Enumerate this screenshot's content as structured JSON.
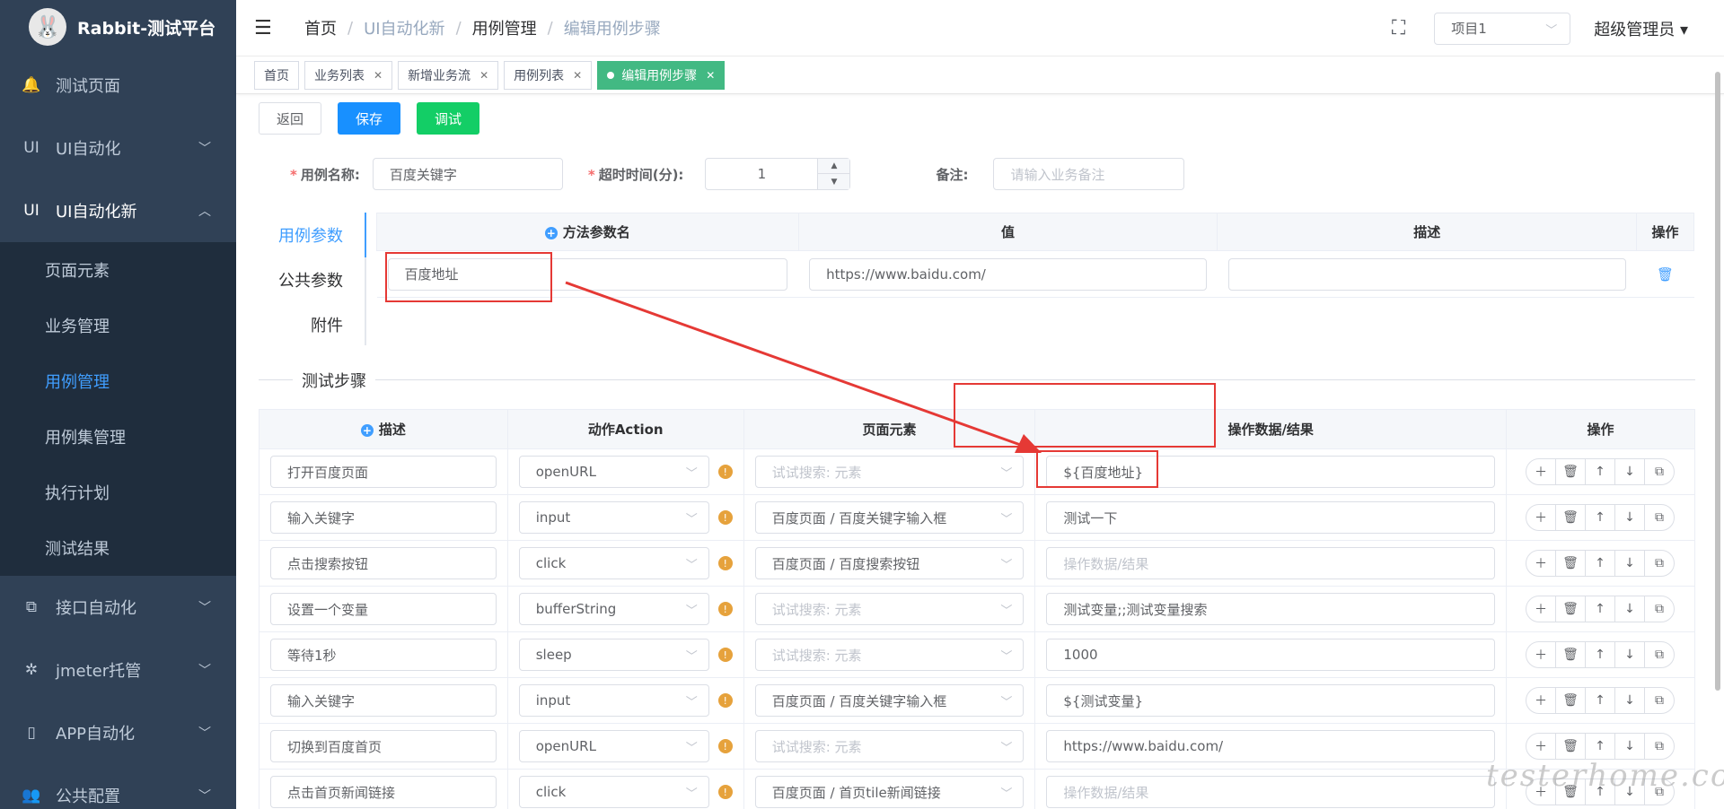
{
  "sidebar": {
    "logo_title": "Rabbit-测试平台",
    "items": [
      {
        "label": "测试页面",
        "icon": "bell-icon"
      },
      {
        "label": "UI自动化",
        "icon_text": "UI"
      },
      {
        "label": "UI自动化新",
        "icon_text": "UI"
      },
      {
        "label": "接口自动化",
        "icon": "api-icon"
      },
      {
        "label": "jmeter托管",
        "icon": "settings-icon"
      },
      {
        "label": "APP自动化",
        "icon": "phone-icon"
      },
      {
        "label": "公共配置",
        "icon": "users-icon"
      }
    ],
    "sub_items": [
      "页面元素",
      "业务管理",
      "用例管理",
      "用例集管理",
      "执行计划",
      "测试结果"
    ],
    "active_sub": "用例管理"
  },
  "header": {
    "breadcrumb": [
      "首页",
      "UI自动化新",
      "用例管理",
      "编辑用例步骤"
    ],
    "project": "项目1",
    "user": "超级管理员"
  },
  "tags": [
    {
      "label": "首页"
    },
    {
      "label": "业务列表"
    },
    {
      "label": "新增业务流"
    },
    {
      "label": "用例列表"
    },
    {
      "label": "编辑用例步骤",
      "active": true
    }
  ],
  "toolbar": {
    "back": "返回",
    "save": "保存",
    "debug": "调试"
  },
  "form": {
    "name_label": "用例名称:",
    "name_value": "百度关键字",
    "timeout_label": "超时时间(分):",
    "timeout_value": "1",
    "remark_label": "备注:",
    "remark_placeholder": "请输入业务备注"
  },
  "param_tabs": [
    "用例参数",
    "公共参数",
    "附件"
  ],
  "param_table": {
    "headers": [
      "方法参数名",
      "值",
      "描述",
      "操作"
    ],
    "rows": [
      {
        "name": "百度地址",
        "value": "https://www.baidu.com/",
        "desc": ""
      }
    ]
  },
  "steps_title": "测试步骤",
  "steps_table": {
    "headers": [
      "描述",
      "动作Action",
      "页面元素",
      "操作数据/结果",
      "操作"
    ],
    "element_placeholder": "试试搜索: 元素",
    "data_placeholder": "操作数据/结果",
    "rows": [
      {
        "desc": "打开百度页面",
        "action": "openURL",
        "element": "",
        "data": "${百度地址}"
      },
      {
        "desc": "输入关键字",
        "action": "input",
        "element": "百度页面 / 百度关键字输入框",
        "data": "测试一下"
      },
      {
        "desc": "点击搜索按钮",
        "action": "click",
        "element": "百度页面 / 百度搜索按钮",
        "data": ""
      },
      {
        "desc": "设置一个变量",
        "action": "bufferString",
        "element": "",
        "data": "测试变量;;测试变量搜索"
      },
      {
        "desc": "等待1秒",
        "action": "sleep",
        "element": "",
        "data": "1000"
      },
      {
        "desc": "输入关键字",
        "action": "input",
        "element": "百度页面 / 百度关键字输入框",
        "data": "${测试变量}"
      },
      {
        "desc": "切换到百度首页",
        "action": "openURL",
        "element": "",
        "data": "https://www.baidu.com/"
      },
      {
        "desc": "点击首页新闻链接",
        "action": "click",
        "element": "百度页面 / 首页tile新闻链接",
        "data": ""
      }
    ]
  },
  "watermark": "testerhome.com",
  "colors": {
    "sidebar_bg": "#304156",
    "accent": "#409eff",
    "active_tag": "#42b983",
    "annotation": "#e53935"
  }
}
